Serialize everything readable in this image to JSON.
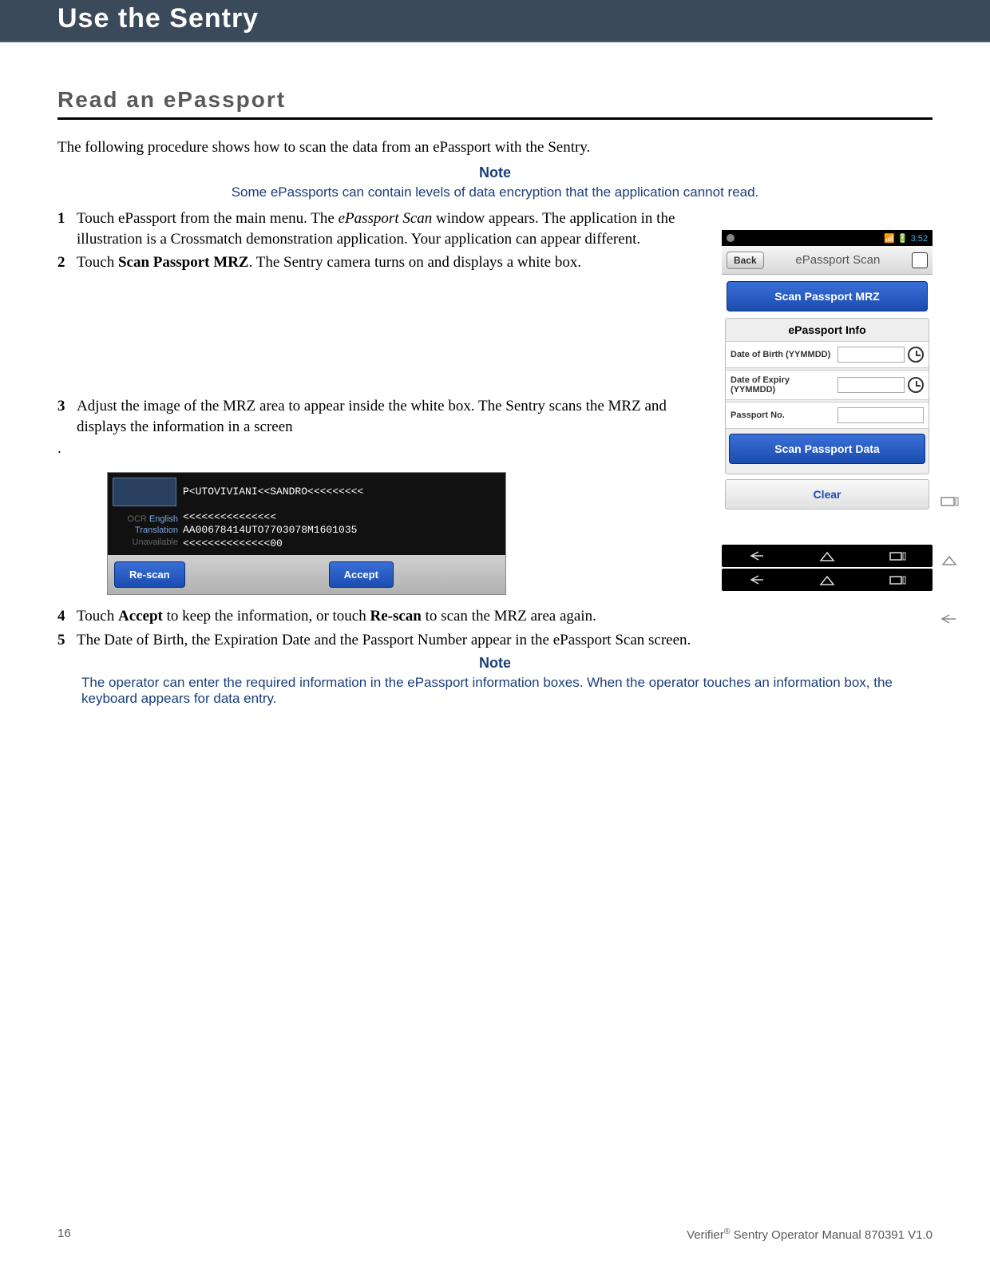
{
  "header": "Use the Sentry",
  "section_title": "Read an ePassport",
  "intro": "The following procedure shows how to scan the data from an ePassport with the Sentry.",
  "note1_label": "Note",
  "note1_body": "Some ePassports can contain levels of data encryption that the application cannot read.",
  "steps": {
    "s1_num": "1",
    "s1a": "Touch ePassport from the main menu. The ",
    "s1b": "ePassport Scan",
    "s1c": " window appears. The application in the illustration is a Crossmatch demonstration application. Your application can appear different.",
    "s2_num": "2",
    "s2a": "Touch ",
    "s2b": "Scan Passport MRZ",
    "s2c": ". The Sentry camera turns on and displays a white box.",
    "s3_num": "3",
    "s3a": "Adjust the image of the MRZ area to appear inside the white box. The Sentry scans the MRZ and displays the information in a screen",
    "dot": ".",
    "s4_num": "4",
    "s4a": "Touch ",
    "s4b": "Accept",
    "s4c": " to keep the information, or touch ",
    "s4d": "Re-scan",
    "s4e": " to scan the MRZ area again.",
    "s5_num": "5",
    "s5a": "The Date of Birth, the Expiration Date and the Passport Number appear in the ePassport Scan screen."
  },
  "note2_label": "Note",
  "note2_body": "The operator can enter the required information in the ePassport information boxes. When the operator touches an information box, the keyboard appears for data entry.",
  "device1": {
    "time": "3:52",
    "back": "Back",
    "title": "ePassport Scan",
    "scan_mrz": "Scan Passport MRZ",
    "panel_title": "ePassport Info",
    "dob_label": "Date of Birth (YYMMDD)",
    "doe_label": "Date of Expiry (YYMMDD)",
    "pno_label": "Passport No.",
    "scan_data": "Scan Passport Data",
    "clear": "Clear"
  },
  "device2": {
    "ocr_lang_label": "OCR",
    "ocr_lang": "English",
    "trans_label": "Translation",
    "trans_val": "Unavailable",
    "mrz_line1": "P<UTOVIVIANI<<SANDRO<<<<<<<<<",
    "mrz_line2": "<<<<<<<<<<<<<<<",
    "mrz_line3": "AA00678414UTO7703078M1601035",
    "mrz_line4": "<<<<<<<<<<<<<<00",
    "rescan": "Re-scan",
    "accept": "Accept"
  },
  "footer": {
    "page": "16",
    "product": "Verifier",
    "rest": " Sentry Operator Manual 870391 V1.0"
  }
}
